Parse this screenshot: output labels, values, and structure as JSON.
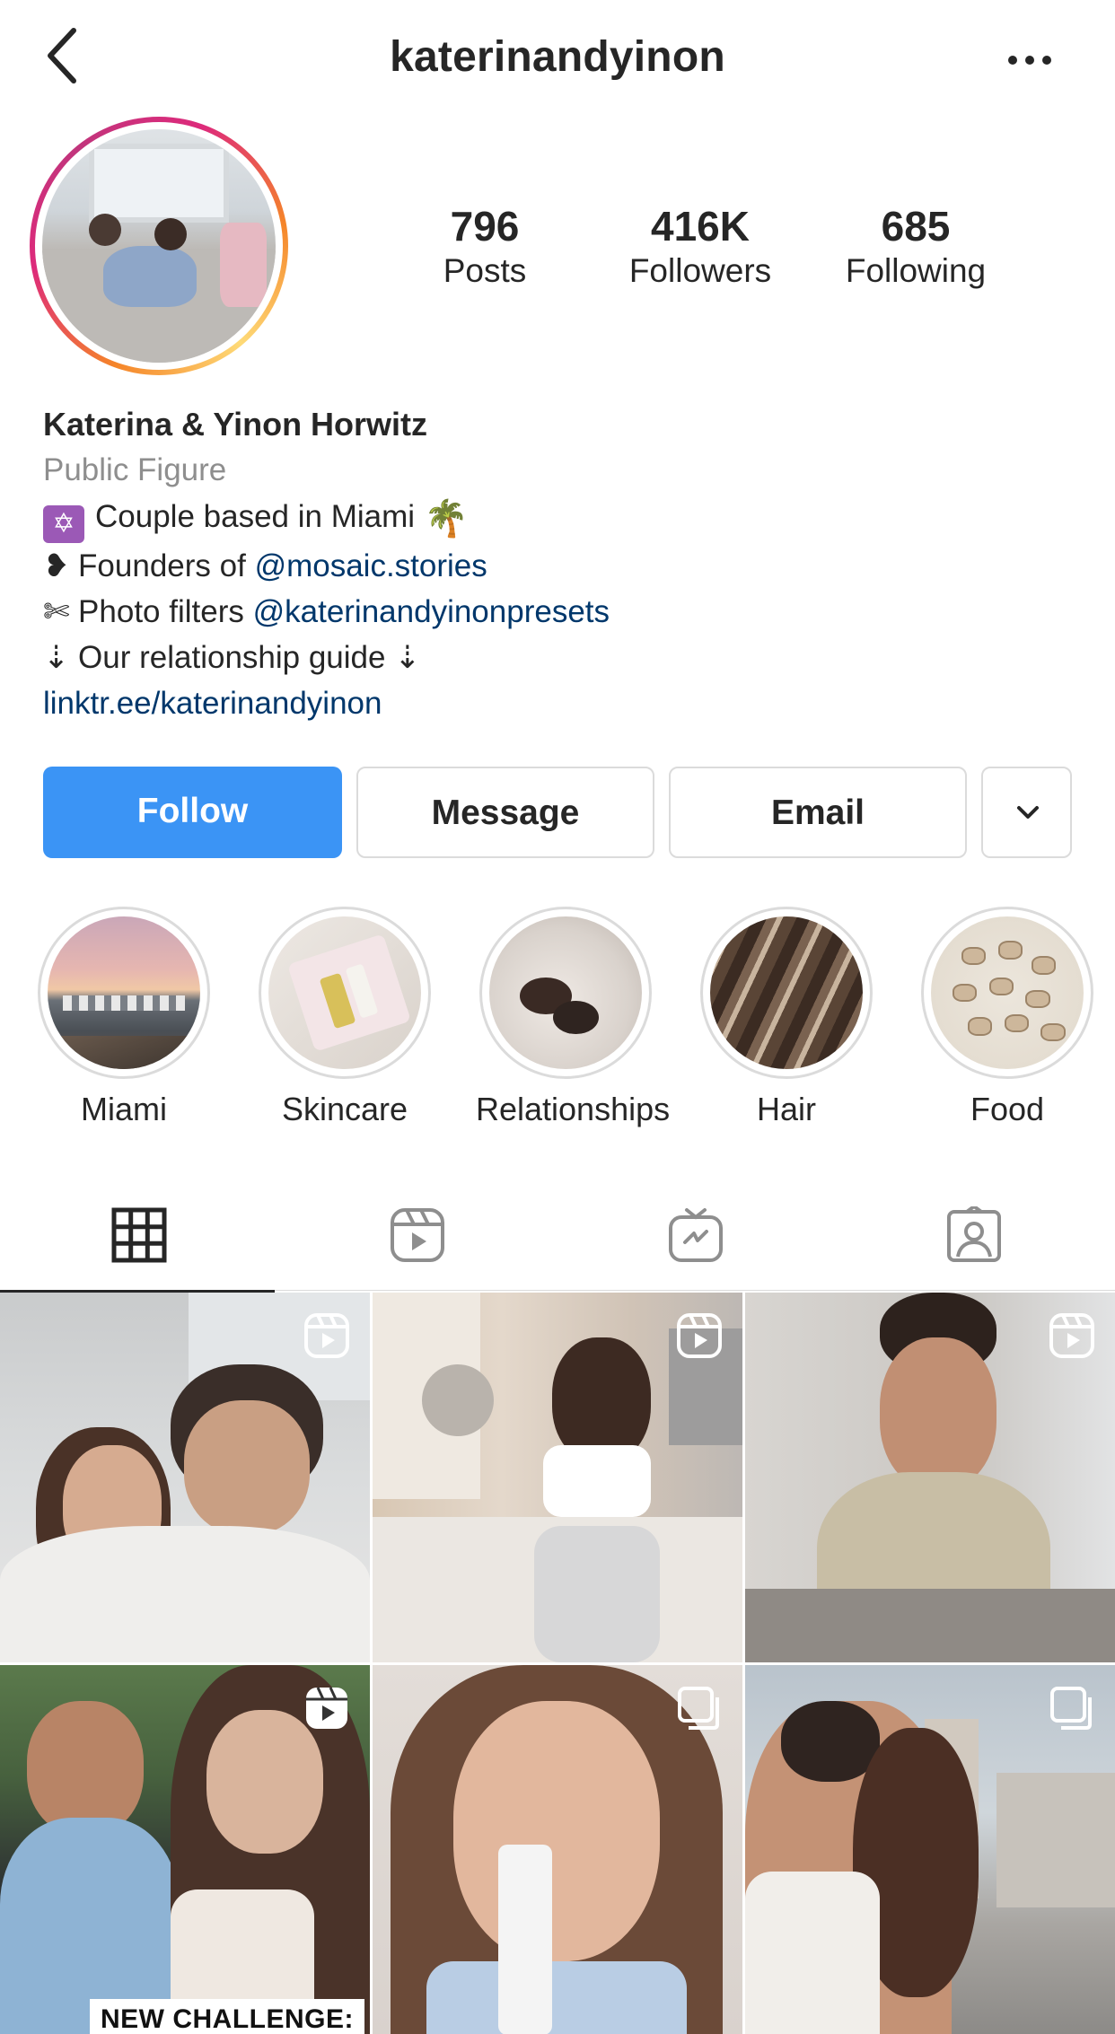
{
  "header": {
    "username": "katerinandyinon"
  },
  "stats": {
    "posts": {
      "value": "796",
      "label": "Posts"
    },
    "followers": {
      "value": "416K",
      "label": "Followers"
    },
    "following": {
      "value": "685",
      "label": "Following"
    }
  },
  "bio": {
    "name": "Katerina & Yinon Horwitz",
    "category": "Public Figure",
    "line1_text": "Couple based in Miami",
    "line1_emoji": "✡",
    "line1_trailing_emoji": "🌴",
    "line2_prefix": "❥ Founders of ",
    "line2_mention": "@mosaic.stories",
    "line3_prefix": "✄ Photo filters ",
    "line3_mention": "@katerinandyinonpresets",
    "line4": "⇣ Our relationship guide ⇣",
    "link": "linktr.ee/katerinandyinon"
  },
  "actions": {
    "follow": "Follow",
    "message": "Message",
    "email": "Email"
  },
  "highlights": [
    {
      "label": "Miami"
    },
    {
      "label": "Skincare"
    },
    {
      "label": "Relationships"
    },
    {
      "label": "Hair"
    },
    {
      "label": "Food"
    }
  ],
  "grid": {
    "post4_caption": "NEW CHALLENGE:"
  },
  "colors": {
    "accent": "#3b94f5",
    "link": "#00376b",
    "muted": "#8e8e8e"
  }
}
